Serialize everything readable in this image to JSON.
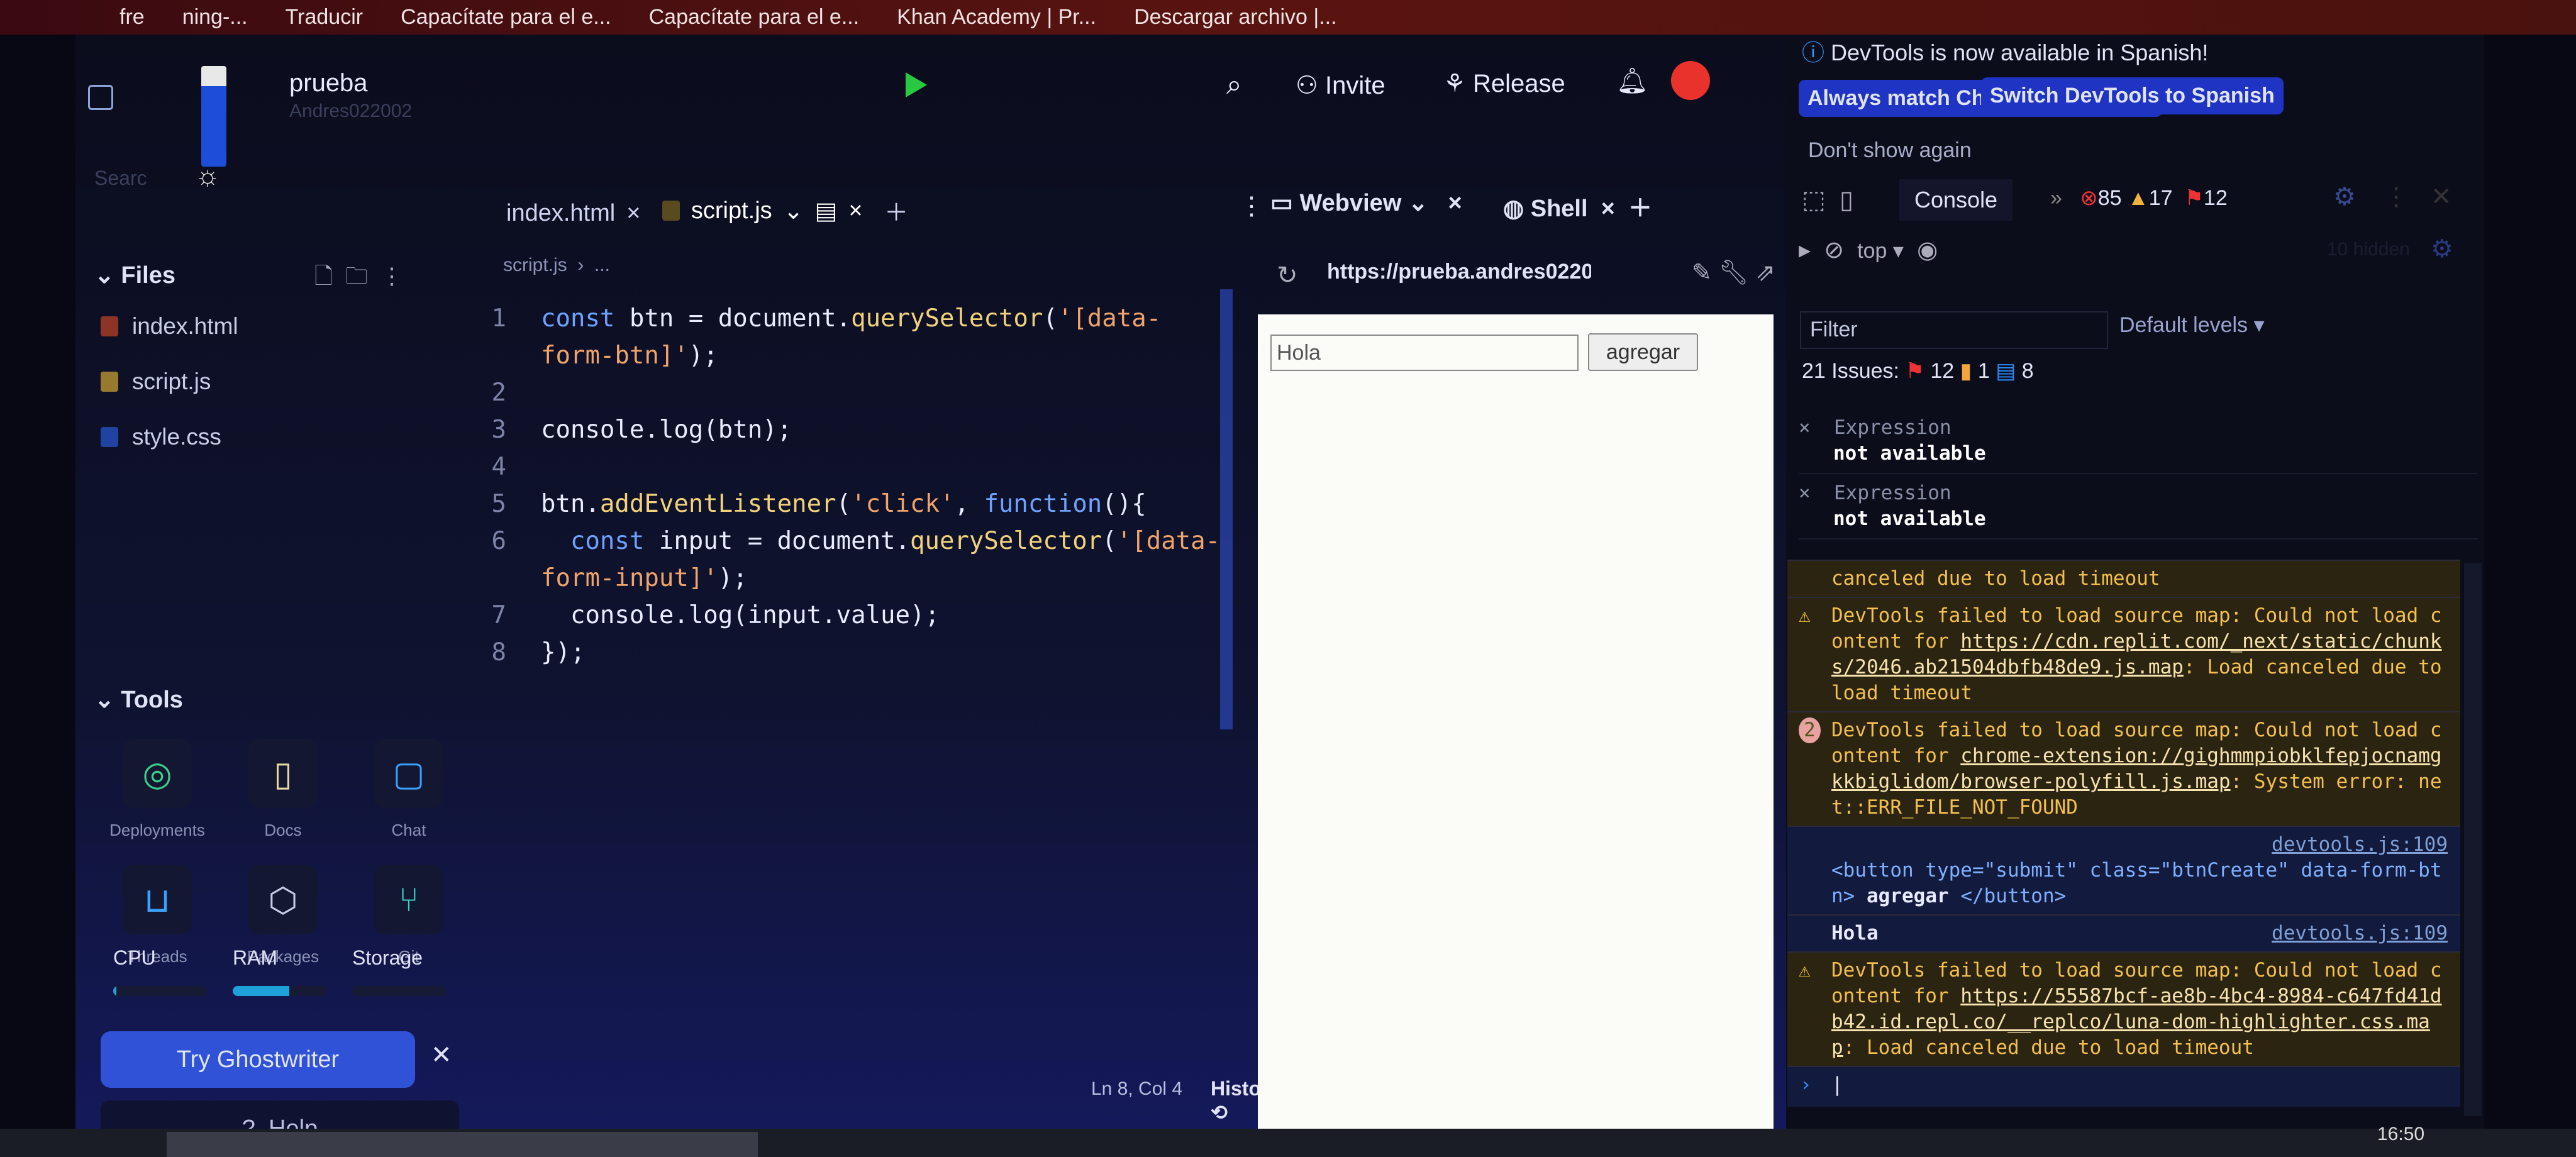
{
  "bookmarks": [
    "fre",
    "ning-...",
    "Traducir",
    "Capacítate para el e...",
    "Capacítate para el e...",
    "Khan Academy | Pr...",
    "Descargar archivo |..."
  ],
  "header": {
    "project": "prueba",
    "owner": "Andres022002",
    "search_placeholder": "Searc",
    "invite": "Invite",
    "release": "Release"
  },
  "sidebar": {
    "files_title": "Files",
    "files": [
      {
        "name": "index.html",
        "color": "#e34c26"
      },
      {
        "name": "script.js",
        "color": "#f1c232"
      },
      {
        "name": "style.css",
        "color": "#2965f1"
      }
    ],
    "tools_title": "Tools",
    "tools": [
      {
        "label": "Deployments",
        "icon": "globe-icon",
        "glyph": "◎",
        "color": "#3ad08a"
      },
      {
        "label": "Docs",
        "icon": "book-icon",
        "glyph": "▯",
        "color": "#e9d9a3"
      },
      {
        "label": "Chat",
        "icon": "chat-icon",
        "glyph": "▢",
        "color": "#3aa0ff"
      },
      {
        "label": "Threads",
        "icon": "inbox-icon",
        "glyph": "⊔",
        "color": "#3aa0ff"
      },
      {
        "label": "Packages",
        "icon": "cube-icon",
        "glyph": "⬡",
        "color": "#c9cde6"
      },
      {
        "label": "Git",
        "icon": "git-branch-icon",
        "glyph": "⑂",
        "color": "#3ad0c0"
      }
    ],
    "resources": [
      {
        "label": "CPU",
        "percent": 3
      },
      {
        "label": "RAM",
        "percent": 60
      },
      {
        "label": "Storage",
        "percent": 0
      }
    ],
    "ghostwriter": "Try Ghostwriter",
    "help": "Help"
  },
  "editor": {
    "tabs": [
      "index.html",
      "script.js"
    ],
    "breadcrumb": "script.js  ›  ...",
    "status": "Ln 8, Col 4",
    "history": "History",
    "lines": [
      {
        "n": "1",
        "tokens": [
          [
            "k",
            "const "
          ],
          [
            "p",
            "btn = document."
          ],
          [
            "f",
            "querySelector"
          ],
          [
            "p",
            "("
          ],
          [
            "s",
            "'[data-"
          ]
        ]
      },
      {
        "n": "",
        "tokens": [
          [
            "s",
            "form-btn]'"
          ],
          [
            "p",
            ");"
          ]
        ]
      },
      {
        "n": "2",
        "tokens": []
      },
      {
        "n": "3",
        "tokens": [
          [
            "p",
            "console.log(btn);"
          ]
        ]
      },
      {
        "n": "4",
        "tokens": []
      },
      {
        "n": "5",
        "tokens": [
          [
            "p",
            "btn."
          ],
          [
            "f",
            "addEventListener"
          ],
          [
            "p",
            "("
          ],
          [
            "s",
            "'click'"
          ],
          [
            "p",
            ", "
          ],
          [
            "k",
            "function"
          ],
          [
            "p",
            "(){"
          ]
        ]
      },
      {
        "n": "6",
        "tokens": [
          [
            "k",
            "  const "
          ],
          [
            "p",
            "input = document."
          ],
          [
            "f",
            "querySelector"
          ],
          [
            "p",
            "("
          ],
          [
            "s",
            "'[data-"
          ]
        ]
      },
      {
        "n": "",
        "tokens": [
          [
            "s",
            "form-input]'"
          ],
          [
            "p",
            ");"
          ]
        ]
      },
      {
        "n": "7",
        "tokens": [
          [
            "p",
            "  console.log(input.value);"
          ]
        ]
      },
      {
        "n": "8",
        "tokens": [
          [
            "p",
            "});"
          ]
        ]
      }
    ]
  },
  "webview": {
    "tab": "Webview",
    "shell_tab": "Shell",
    "url": "https://prueba.andres0220",
    "input_value": "Hola",
    "button": "agregar"
  },
  "devtools": {
    "notice": "DevTools is now available in Spanish!",
    "btn_match": "Always match Chrome's language",
    "btn_switch": "Switch DevTools to Spanish",
    "dont_show": "Don't show again",
    "tab": "Console",
    "errors": "85",
    "warnings": "17",
    "issues_badge": "12",
    "context": "top",
    "filter_placeholder": "Filter",
    "levels": "Default levels",
    "hidden": "10 hidden",
    "issues": {
      "label": "21 Issues:",
      "red": "12",
      "orange": "1",
      "blue": "8"
    },
    "expressions": [
      {
        "label": "Expression",
        "value": "not available"
      },
      {
        "label": "Expression",
        "value": "not available"
      }
    ],
    "messages": [
      {
        "type": "warn",
        "icon": "",
        "parts": [
          [
            "",
            "canceled due to load timeout"
          ]
        ]
      },
      {
        "type": "warn",
        "icon": "⚠",
        "parts": [
          [
            "",
            "DevTools failed to load source map: Could not load content for "
          ],
          [
            "link",
            "https://cdn.replit.com/_next/static/chunks/2046.ab21504dbfb48de9.js.map"
          ],
          [
            "",
            ": Load canceled due to load timeout"
          ]
        ]
      },
      {
        "type": "warn",
        "icon": "2",
        "parts": [
          [
            "",
            "DevTools failed to load source map: Could not load content for "
          ],
          [
            "link",
            "chrome-extension://gighmmpiobklfepjocnamgkkbiglidom/browser-polyfill.js.map"
          ],
          [
            "",
            ": System error: net::ERR_FILE_NOT_FOUND"
          ]
        ]
      },
      {
        "type": "log",
        "icon": "",
        "src": "devtools.js:109",
        "parts": [
          [
            "tag",
            "<button type=\"submit\" class=\"btnCreate\" data-form-btn> "
          ],
          [
            "",
            "agregar"
          ],
          [
            "tag",
            " </button>"
          ]
        ]
      },
      {
        "type": "log",
        "icon": "",
        "src": "devtools.js:109",
        "parts": [
          [
            "",
            "Hola"
          ]
        ]
      },
      {
        "type": "warn",
        "icon": "⚠",
        "parts": [
          [
            "",
            "DevTools failed to load source map: Could not load content for "
          ],
          [
            "link",
            "https://55587bcf-ae8b-4bc4-8984-c647fd41db42.id.repl.co/__replco/luna-dom-highlighter.css.map"
          ],
          [
            "",
            ": Load canceled due to load timeout"
          ]
        ]
      }
    ]
  },
  "taskbar": {
    "clock": "16:50"
  }
}
